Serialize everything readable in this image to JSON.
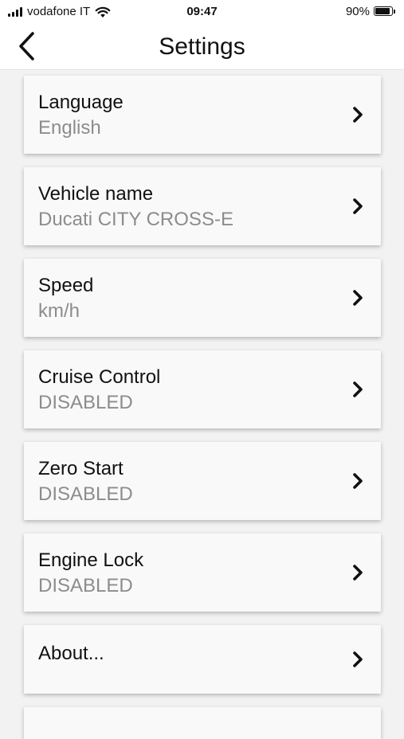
{
  "status_bar": {
    "carrier": "vodafone IT",
    "time": "09:47",
    "battery_percent_label": "90%",
    "battery_level": 0.9
  },
  "nav": {
    "title": "Settings",
    "back_icon": "chevron-left-icon"
  },
  "settings": [
    {
      "title": "Language",
      "value": "English"
    },
    {
      "title": "Vehicle name",
      "value": "Ducati CITY CROSS-E"
    },
    {
      "title": "Speed",
      "value": "km/h"
    },
    {
      "title": "Cruise Control",
      "value": "DISABLED"
    },
    {
      "title": "Zero Start",
      "value": "DISABLED"
    },
    {
      "title": "Engine Lock",
      "value": "DISABLED"
    },
    {
      "title": "About...",
      "value": ""
    }
  ],
  "colors": {
    "background": "#f2f2f2",
    "card": "#f9f9f9",
    "secondary_text": "#8c8c8c"
  }
}
